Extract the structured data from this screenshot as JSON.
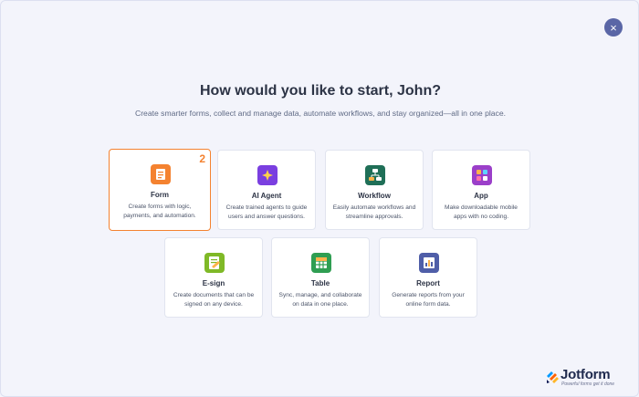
{
  "close_label": "×",
  "heading": "How would you like to start, John?",
  "subheading": "Create smarter forms, collect and manage data, automate workflows, and stay organized—all in one place.",
  "cards": [
    {
      "name": "Form",
      "desc": "Create forms with logic, payments, and automation.",
      "icon": "form-icon",
      "color": "#f48230",
      "badge": "2",
      "selected": true
    },
    {
      "name": "AI Agent",
      "desc": "Create trained agents to guide users and answer questions.",
      "icon": "ai-agent-icon",
      "color": "#7a3fe0"
    },
    {
      "name": "Workflow",
      "desc": "Easily automate workflows and streamline approvals.",
      "icon": "workflow-icon",
      "color": "#1f6f57"
    },
    {
      "name": "App",
      "desc": "Make downloadable mobile apps with no coding.",
      "icon": "app-icon",
      "color": "#9b3fc9"
    },
    {
      "name": "E-sign",
      "desc": "Create documents that can be signed on any device.",
      "icon": "esign-icon",
      "color": "#7fb927"
    },
    {
      "name": "Table",
      "desc": "Sync, manage, and collaborate on data in one place.",
      "icon": "table-icon",
      "color": "#2f9e52"
    },
    {
      "name": "Report",
      "desc": "Generate reports from your online form data.",
      "icon": "report-icon",
      "color": "#4f5ea8"
    }
  ],
  "logo": {
    "name": "Jotform",
    "tagline": "Powerful forms get it done"
  }
}
